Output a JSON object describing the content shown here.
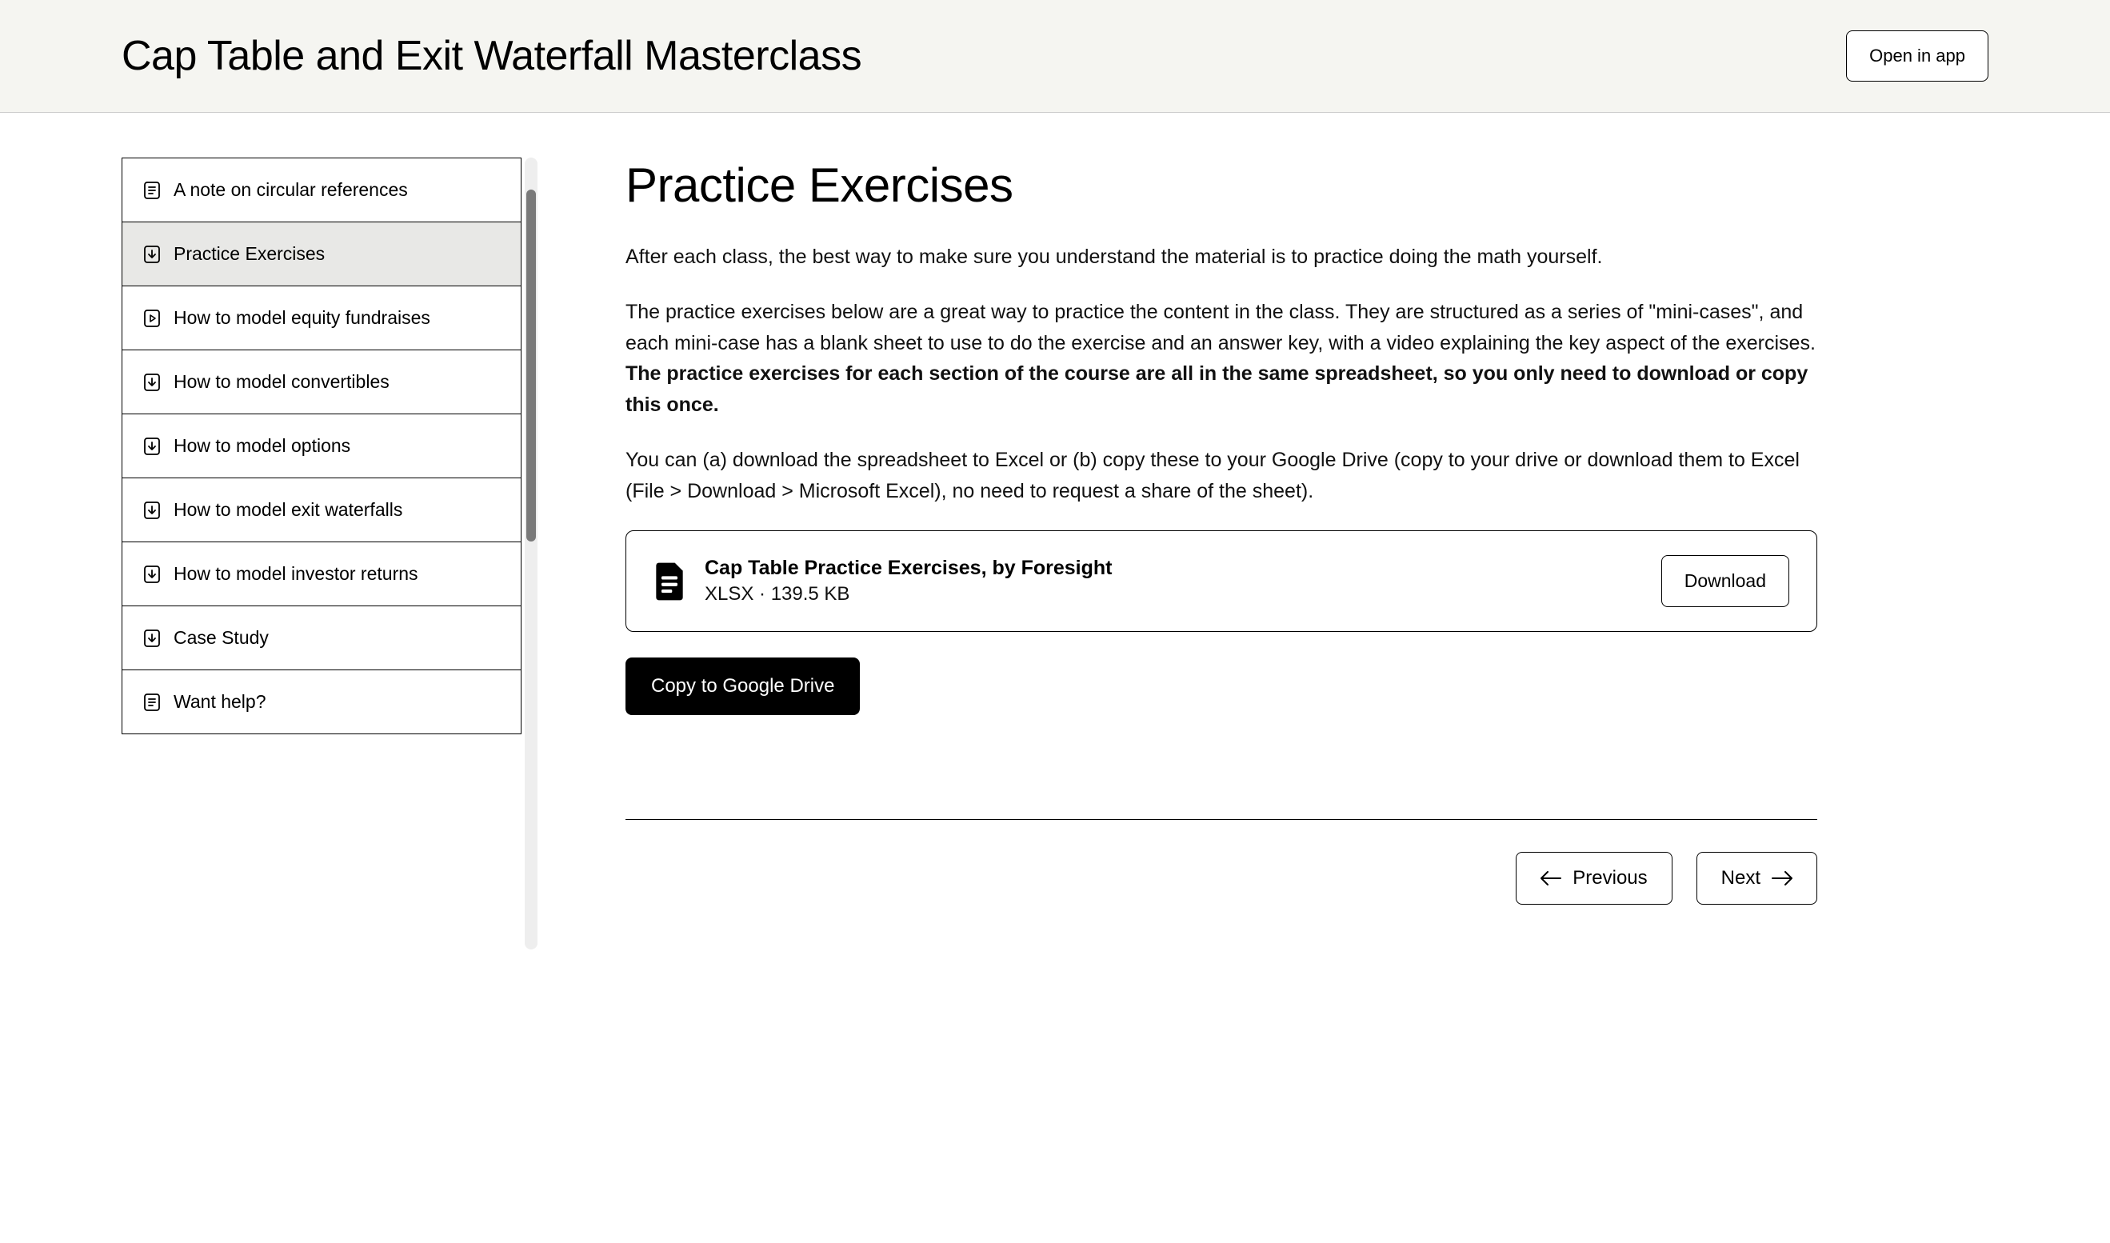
{
  "header": {
    "title": "Cap Table and Exit Waterfall Masterclass",
    "open_app": "Open in app"
  },
  "sidebar": {
    "items": [
      {
        "icon": "doc",
        "label": "A note on circular references",
        "active": false
      },
      {
        "icon": "download",
        "label": "Practice Exercises",
        "active": true
      },
      {
        "icon": "play",
        "label": "How to model equity fundraises",
        "active": false
      },
      {
        "icon": "download",
        "label": "How to model convertibles",
        "active": false
      },
      {
        "icon": "download",
        "label": "How to model options",
        "active": false
      },
      {
        "icon": "download",
        "label": "How to model exit waterfalls",
        "active": false
      },
      {
        "icon": "download",
        "label": "How to model investor returns",
        "active": false
      },
      {
        "icon": "download",
        "label": "Case Study",
        "active": false
      },
      {
        "icon": "doc",
        "label": "Want help?",
        "active": false
      }
    ]
  },
  "main": {
    "title": "Practice Exercises",
    "para1": "After each class, the best way to make sure you understand the material is to practice doing the math yourself.",
    "para2a": "The practice exercises below are a great way to practice the content in the class. They are structured as a series of \"mini-cases\", and each mini-case has a blank sheet to use to do the exercise and an answer key, with a video explaining the key aspect of the exercises. ",
    "para2b": "The practice exercises for each section of the course are all in the same spreadsheet, so you only need to download or copy this once.",
    "para3": "You can (a) download the spreadsheet to Excel or (b) copy these to your Google Drive (copy to your drive or download them to Excel (File > Download > Microsoft Excel), no need to request a share of the sheet).",
    "file": {
      "name": "Cap Table Practice Exercises, by Foresight",
      "meta": "XLSX · 139.5 KB",
      "download": "Download"
    },
    "copy_drive": "Copy to Google Drive",
    "prev": "Previous",
    "next": "Next"
  }
}
